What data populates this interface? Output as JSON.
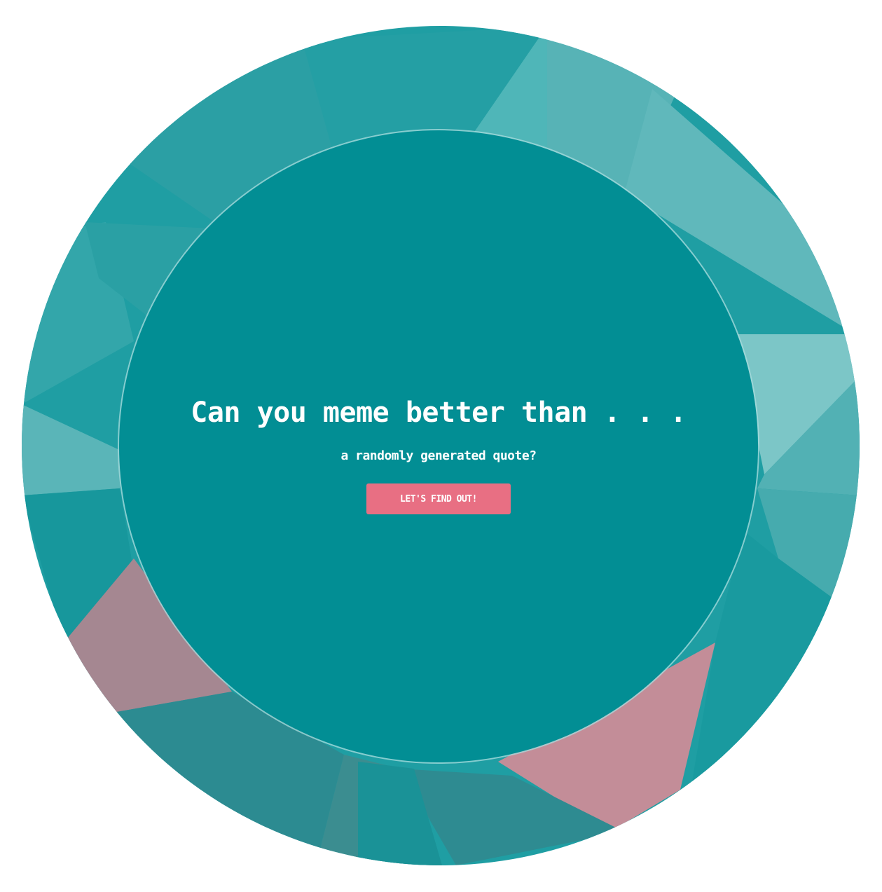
{
  "hero": {
    "headline": "Can you meme better than . . .",
    "subline": "a randomly generated quote?",
    "cta_label": "LET'S FIND OUT!"
  },
  "colors": {
    "inner_disc": "#028e94",
    "button": "#e86f83",
    "text": "#ffffff",
    "teal_light": "#7cc6c7",
    "teal_mid": "#33a6aa",
    "pink_muted": "#b8848f"
  }
}
